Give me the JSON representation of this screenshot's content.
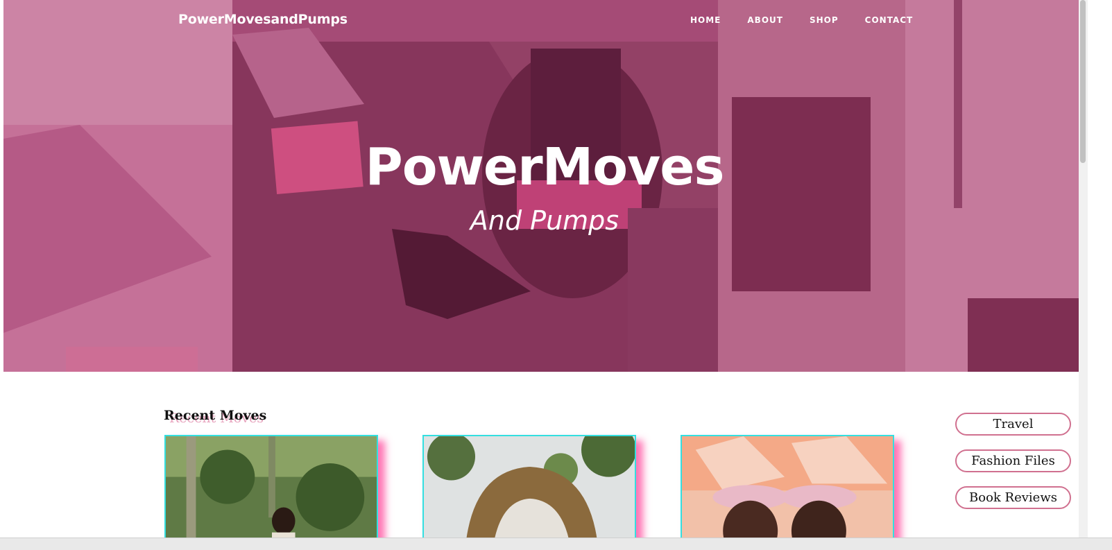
{
  "nav": {
    "brand": "PowerMovesandPumps",
    "links": [
      "HOME",
      "ABOUT",
      "SHOP",
      "CONTACT"
    ]
  },
  "hero": {
    "title": "PowerMoves",
    "subtitle": "And Pumps"
  },
  "recent": {
    "heading": "Recent Moves",
    "cards": [
      "post-thumbnail-1",
      "post-thumbnail-2",
      "post-thumbnail-3"
    ]
  },
  "categories": [
    "Travel",
    "Fashion Files",
    "Book Reviews"
  ],
  "colors": {
    "accent_pink": "#d0708f",
    "card_border": "#33dfe0",
    "card_glow": "#ff3c96",
    "hero_tint": "#a03064"
  }
}
